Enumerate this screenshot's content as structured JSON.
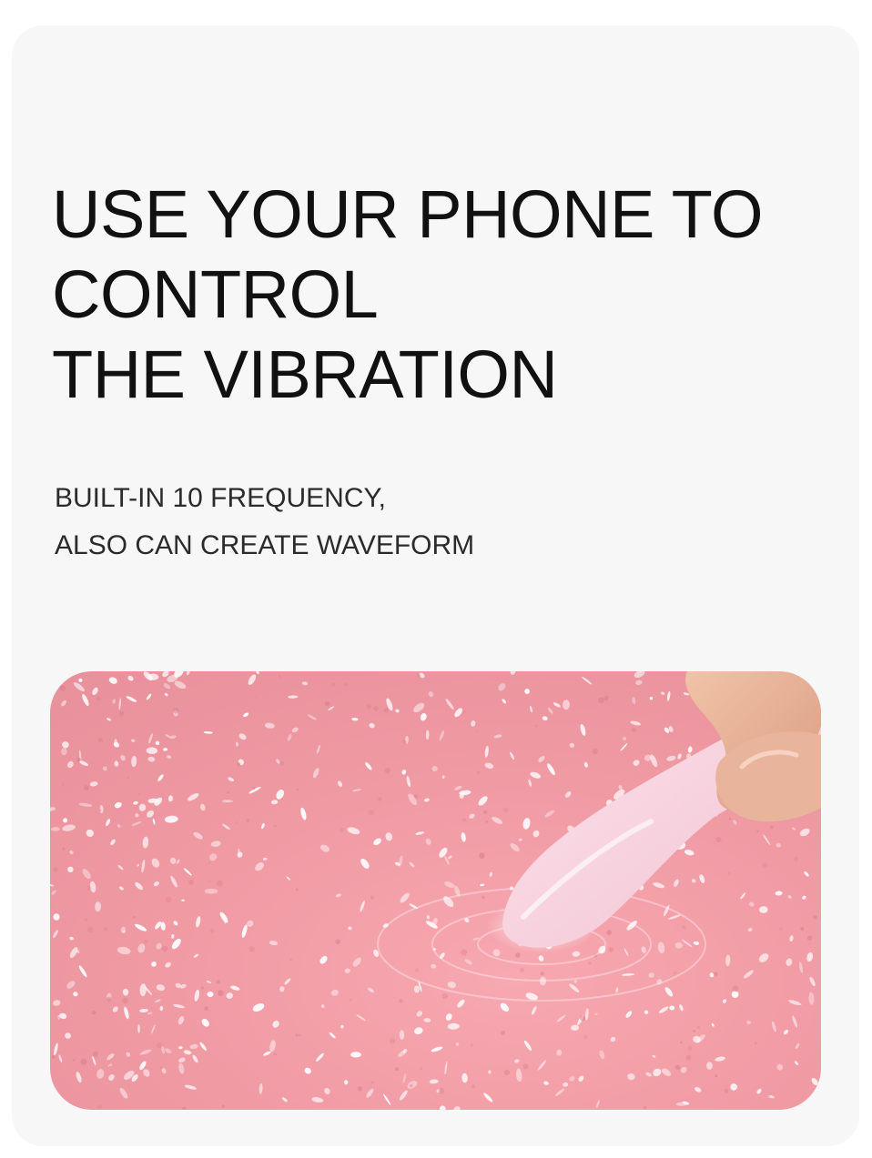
{
  "headline": {
    "line1": "USE YOUR PHONE TO",
    "line2": "CONTROL",
    "line3": "THE VIBRATION"
  },
  "subheadline": {
    "line1": "BUILT-IN 10 FREQUENCY,",
    "line2": "ALSO CAN CREATE WAVEFORM"
  },
  "colors": {
    "card_background": "#f7f7f7",
    "headline_text": "#111111",
    "water_pink": "#f19aa4"
  }
}
